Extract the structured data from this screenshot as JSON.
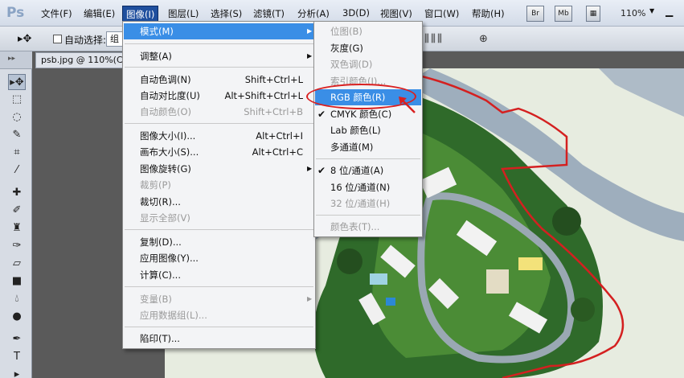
{
  "app": {
    "logo": "Ps",
    "zoom": "110%"
  },
  "menubar": {
    "items": [
      "文件(F)",
      "编辑(E)",
      "图像(I)",
      "图层(L)",
      "选择(S)",
      "滤镜(T)",
      "分析(A)",
      "3D(D)",
      "视图(V)",
      "窗口(W)",
      "帮助(H)"
    ],
    "bridge_label": "Br",
    "minibridge_label": "Mb"
  },
  "options": {
    "auto_select_label": "自动选择:",
    "auto_select_value": "组"
  },
  "document": {
    "tab_title": "psb.jpg @ 110%(CM"
  },
  "image_menu": {
    "items": [
      {
        "label": "模式(M)",
        "shortcut": "",
        "submenu": true,
        "disabled": false,
        "highlighted": true
      },
      {
        "label": "调整(A)",
        "shortcut": "",
        "submenu": true,
        "disabled": false
      },
      {
        "label": "自动色调(N)",
        "shortcut": "Shift+Ctrl+L",
        "disabled": false
      },
      {
        "label": "自动对比度(U)",
        "shortcut": "Alt+Shift+Ctrl+L",
        "disabled": false
      },
      {
        "label": "自动颜色(O)",
        "shortcut": "Shift+Ctrl+B",
        "disabled": true
      },
      {
        "label": "图像大小(I)...",
        "shortcut": "Alt+Ctrl+I",
        "disabled": false
      },
      {
        "label": "画布大小(S)...",
        "shortcut": "Alt+Ctrl+C",
        "disabled": false
      },
      {
        "label": "图像旋转(G)",
        "shortcut": "",
        "submenu": true,
        "disabled": false
      },
      {
        "label": "裁剪(P)",
        "shortcut": "",
        "disabled": true
      },
      {
        "label": "裁切(R)...",
        "shortcut": "",
        "disabled": false
      },
      {
        "label": "显示全部(V)",
        "shortcut": "",
        "disabled": true
      },
      {
        "label": "复制(D)...",
        "shortcut": "",
        "disabled": false
      },
      {
        "label": "应用图像(Y)...",
        "shortcut": "",
        "disabled": false
      },
      {
        "label": "计算(C)...",
        "shortcut": "",
        "disabled": false
      },
      {
        "label": "变量(B)",
        "shortcut": "",
        "submenu": true,
        "disabled": true
      },
      {
        "label": "应用数据组(L)...",
        "shortcut": "",
        "disabled": true
      },
      {
        "label": "陷印(T)...",
        "shortcut": "",
        "disabled": false
      }
    ]
  },
  "mode_menu": {
    "items": [
      {
        "label": "位图(B)",
        "disabled": true,
        "checked": false
      },
      {
        "label": "灰度(G)",
        "disabled": false,
        "checked": false
      },
      {
        "label": "双色调(D)",
        "disabled": true,
        "checked": false
      },
      {
        "label": "索引颜色(I)...",
        "disabled": true,
        "checked": false
      },
      {
        "label": "RGB 颜色(R)",
        "disabled": false,
        "checked": false,
        "highlighted": true
      },
      {
        "label": "CMYK 颜色(C)",
        "disabled": false,
        "checked": true
      },
      {
        "label": "Lab 颜色(L)",
        "disabled": false,
        "checked": false
      },
      {
        "label": "多通道(M)",
        "disabled": false,
        "checked": false
      },
      {
        "label": "8 位/通道(A)",
        "disabled": false,
        "checked": true
      },
      {
        "label": "16 位/通道(N)",
        "disabled": false,
        "checked": false
      },
      {
        "label": "32 位/通道(H)",
        "disabled": true,
        "checked": false
      },
      {
        "label": "颜色表(T)...",
        "disabled": true,
        "checked": false
      }
    ]
  },
  "colors": {
    "highlight": "#3a8ee6",
    "annotation": "#d92020",
    "active_menu": "#1f4f9e"
  }
}
